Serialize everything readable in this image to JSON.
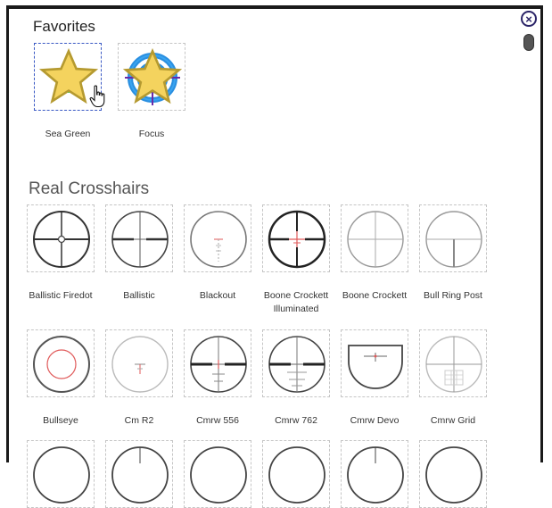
{
  "favorites": {
    "title": "Favorites",
    "items": [
      {
        "label": "Sea Green",
        "icon": "crosshair-plus-icon",
        "selected": true,
        "favorite": true
      },
      {
        "label": "Focus",
        "icon": "target-focus-icon",
        "selected": false,
        "favorite": true
      }
    ]
  },
  "real": {
    "title": "Real Crosshairs",
    "items": [
      {
        "label": "Ballistic Firedot",
        "icon": "scope-ballistic-firedot-icon"
      },
      {
        "label": "Ballistic",
        "icon": "scope-ballistic-icon"
      },
      {
        "label": "Blackout",
        "icon": "scope-blackout-icon"
      },
      {
        "label": "Boone Crockett Illuminated",
        "line1": "Boone Crockett",
        "line2": "Illuminated",
        "icon": "scope-boone-illuminated-icon"
      },
      {
        "label": "Boone Crockett",
        "icon": "scope-boone-crockett-icon"
      },
      {
        "label": "Bull Ring Post",
        "icon": "scope-bull-ring-post-icon"
      },
      {
        "label": "Bullseye",
        "icon": "scope-bullseye-icon"
      },
      {
        "label": "Cm R2",
        "icon": "scope-cm-r2-icon"
      },
      {
        "label": "Cmrw 556",
        "icon": "scope-cmrw-556-icon"
      },
      {
        "label": "Cmrw 762",
        "icon": "scope-cmrw-762-icon"
      },
      {
        "label": "Cmrw Devo",
        "icon": "scope-cmrw-devo-icon"
      },
      {
        "label": "Cmrw Grid",
        "icon": "scope-cmrw-grid-icon"
      }
    ]
  },
  "colors": {
    "accent_green": "#2ee07a",
    "focus_blue": "#2a8fe0",
    "focus_purple": "#6a2aa8",
    "star": "#f4d35e",
    "red": "#e05a5a"
  }
}
